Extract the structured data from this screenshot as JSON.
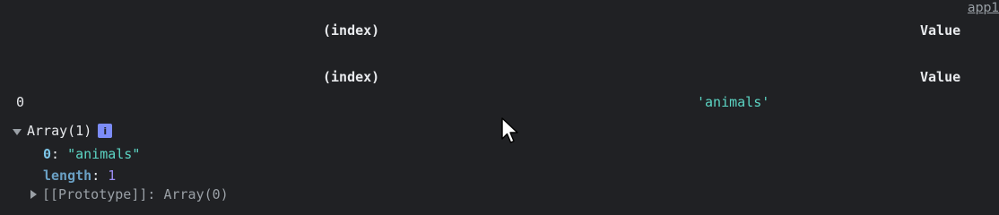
{
  "source_link": "app1",
  "table": {
    "headers": {
      "index": "(index)",
      "value": "Value"
    },
    "rows": [
      {
        "index": "0",
        "value": "'animals'"
      }
    ]
  },
  "array": {
    "label": "Array(1)",
    "info_badge": "i",
    "props": [
      {
        "key": "0",
        "value": "\"animals\""
      },
      {
        "key": "length",
        "value": "1"
      }
    ],
    "prototype_row": "[[Prototype]]: Array(0)"
  },
  "colors": {
    "background": "#202124",
    "string": "#5cd5c4",
    "number": "#9b8cf2",
    "key": "#7dc6e9",
    "badge": "#7c8cf8"
  },
  "icons": {
    "expand": "triangle-down-icon",
    "collapsed": "triangle-right-icon",
    "info": "info-icon",
    "cursor": "mouse-pointer-icon"
  }
}
